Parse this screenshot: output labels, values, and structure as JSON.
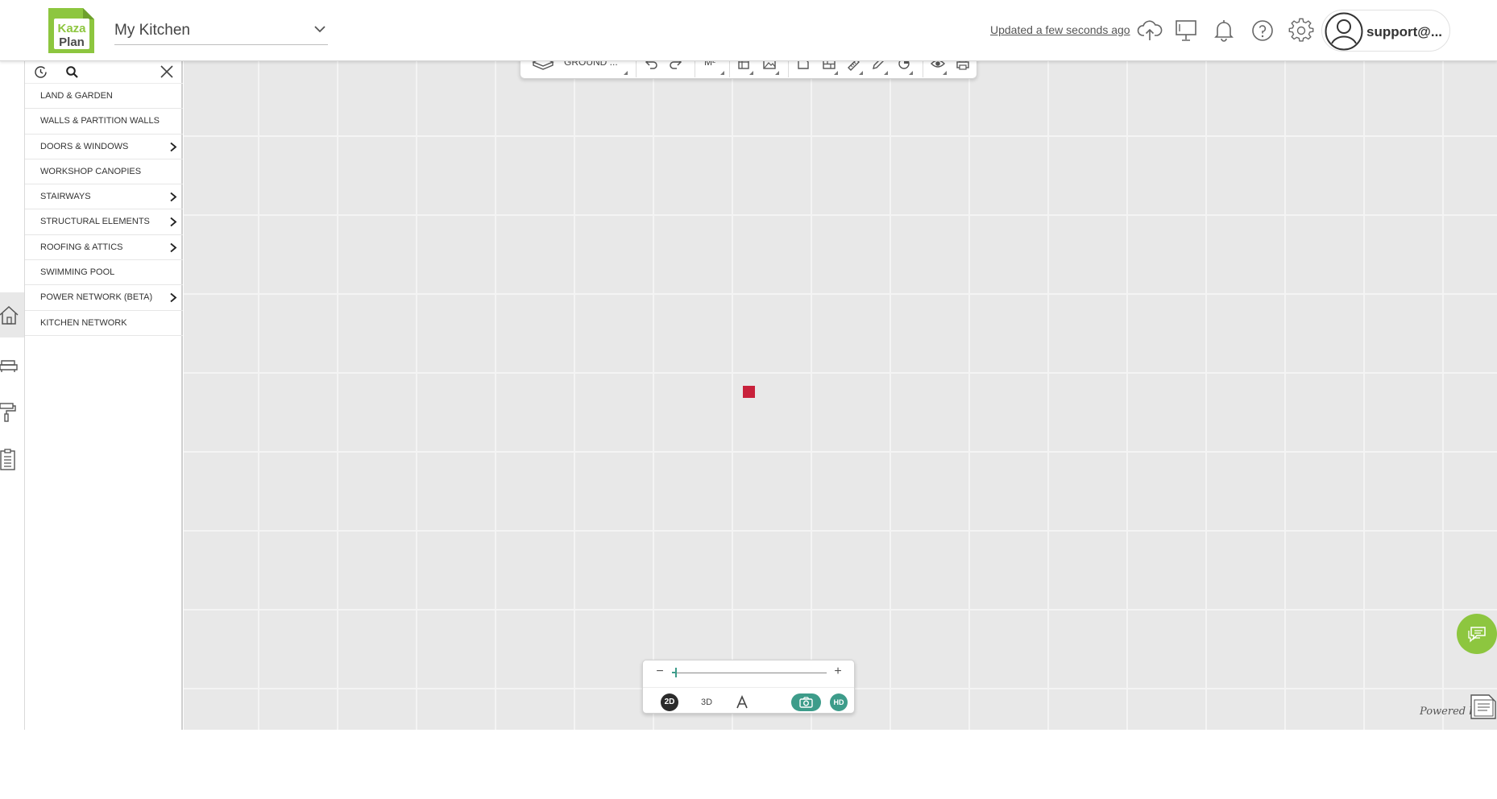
{
  "colors": {
    "brand_green": "#8dc63f",
    "accent_teal": "#3d9c8a",
    "marker_red": "#c8213b",
    "canvas_bg": "#e8e8e8"
  },
  "header": {
    "logo_text_top": "Kaza",
    "logo_text_bottom": "Plan",
    "project_name": "My Kitchen",
    "updated_status": "Updated a few seconds ago",
    "user_name": "support@...",
    "icons": [
      "cloud-upload-icon",
      "presentation-icon",
      "bell-icon",
      "help-icon",
      "gear-icon",
      "user-avatar-icon"
    ]
  },
  "rail": {
    "items": [
      {
        "name": "house-icon",
        "active": true
      },
      {
        "name": "sofa-icon",
        "active": false
      },
      {
        "name": "paint-roller-icon",
        "active": false
      },
      {
        "name": "clipboard-icon",
        "active": false
      }
    ]
  },
  "catalog": {
    "items": [
      {
        "label": "LAND & GARDEN",
        "has_children": false
      },
      {
        "label": "WALLS & PARTITION WALLS",
        "has_children": false
      },
      {
        "label": "DOORS & WINDOWS",
        "has_children": true
      },
      {
        "label": "WORKSHOP CANOPIES",
        "has_children": false
      },
      {
        "label": "STAIRWAYS",
        "has_children": true
      },
      {
        "label": "STRUCTURAL ELEMENTS",
        "has_children": true
      },
      {
        "label": "ROOFING & ATTICS",
        "has_children": true
      },
      {
        "label": "SWIMMING POOL",
        "has_children": false
      },
      {
        "label": "POWER NETWORK (BETA)",
        "has_children": true
      },
      {
        "label": "KITCHEN NETWORK",
        "has_children": false
      }
    ]
  },
  "toolbar": {
    "level": "GROUND ...",
    "unit": "M²"
  },
  "view_controls": {
    "zoom_minus": "−",
    "zoom_plus": "+",
    "zoom_level_fraction": 0.02,
    "mode_2d": "2D",
    "mode_3d": "3D",
    "hd": "HD"
  },
  "footer": {
    "powered_by": "Powered by"
  }
}
